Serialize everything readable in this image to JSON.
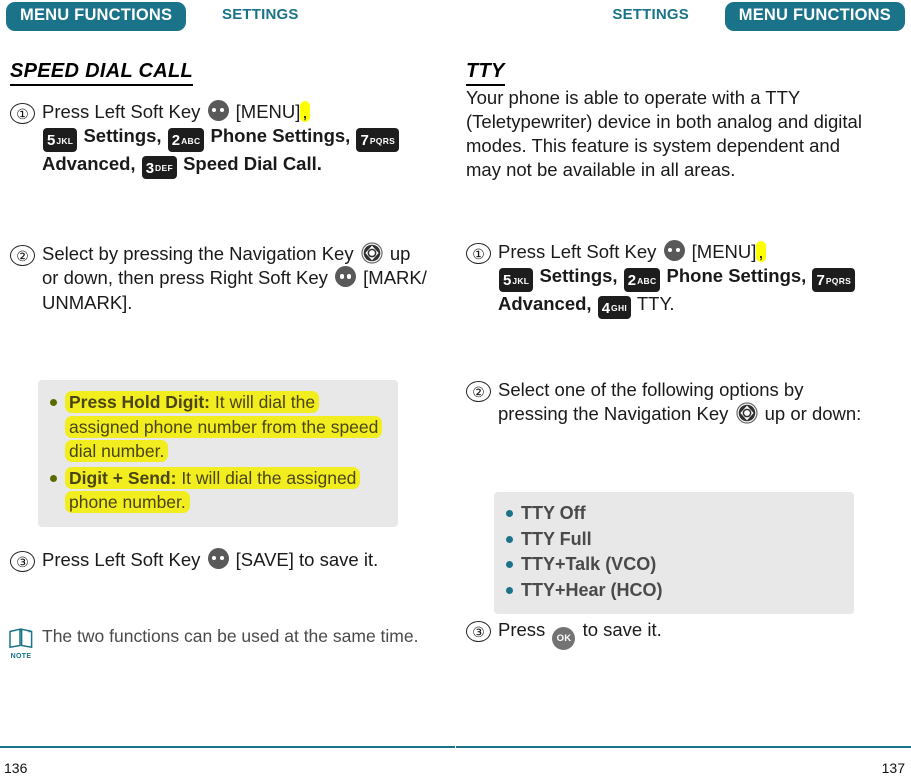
{
  "left_page": {
    "header": {
      "tab": "MENU FUNCTIONS",
      "sub": "SETTINGS"
    },
    "section_title": "SPEED DIAL CALL",
    "steps": [
      {
        "num": "①",
        "text_1": "Press Left Soft Key",
        "soft_key_icon": "soft-key-icon",
        "text_2": "[MENU]",
        "comma_highlight": ",",
        "key_5": {
          "digit": "5",
          "letters": "JKL"
        },
        "label_settings": "Settings,",
        "key_2": {
          "digit": "2",
          "letters": "ABC"
        },
        "label_phone_settings": "Phone Settings,",
        "key_7": {
          "digit": "7",
          "letters": "PQRS"
        },
        "label_advanced": "Advanced,",
        "key_3": {
          "digit": "3",
          "letters": "DEF"
        },
        "label_speed_dial": "Speed Dial Call."
      },
      {
        "num": "②",
        "text_1": "Select by pressing the Navigation Key",
        "nav_key_icon": "navigation-key-icon",
        "text_2": "up or down, then press Right Soft Key",
        "soft_key_icon": "soft-key-icon",
        "text_3": "[MARK/ UNMARK]."
      },
      {
        "num": "③",
        "text_1": "Press Left Soft Key",
        "soft_key_icon": "soft-key-icon",
        "text_2": "[SAVE] to save it."
      }
    ],
    "info_box": {
      "bullets": [
        {
          "bold": "Press Hold Digit:",
          "rest": "It will dial the assigned phone number from the speed dial number."
        },
        {
          "bold": "Digit + Send:",
          "rest": "It will dial the assigned phone number."
        }
      ]
    },
    "note": {
      "icon": "note-book-icon",
      "icon_label": "NOTE",
      "text": "The two functions can be used at the same time."
    },
    "page_number": "136"
  },
  "right_page": {
    "header": {
      "tab": "MENU FUNCTIONS",
      "sub": "SETTINGS"
    },
    "section_title": "TTY",
    "intro": "Your phone is able to operate with a TTY (Teletypewriter) device in both analog and digital modes. This feature is system dependent and may not be available in all areas.",
    "steps": [
      {
        "num": "①",
        "text_1": "Press Left Soft Key",
        "soft_key_icon": "soft-key-icon",
        "text_2": "[MENU]",
        "comma_highlight": ",",
        "key_5": {
          "digit": "5",
          "letters": "JKL"
        },
        "label_settings": "Settings,",
        "key_2": {
          "digit": "2",
          "letters": "ABC"
        },
        "label_phone_settings": "Phone Settings,",
        "key_7": {
          "digit": "7",
          "letters": "PQRS"
        },
        "label_advanced": "Advanced,",
        "key_4": {
          "digit": "4",
          "letters": "GHI"
        },
        "label_tty": "TTY."
      },
      {
        "num": "②",
        "text_1": "Select one of the following options by pressing the Navigation Key",
        "nav_key_icon": "navigation-key-icon",
        "text_2": "up or down:"
      },
      {
        "num": "③",
        "text_1": "Press",
        "ok_key_icon": "ok-key-icon",
        "ok_key_label": "OK",
        "text_2": "to save it."
      }
    ],
    "options_box": {
      "options": [
        "TTY Off",
        "TTY Full",
        "TTY+Talk (VCO)",
        "TTY+Hear (HCO)"
      ]
    },
    "page_number": "137"
  },
  "colors": {
    "brand_teal": "#1a7389",
    "highlight_yellow": "#f2ed1e",
    "key_black": "#1d1d1d",
    "box_gray": "#e8e8e8",
    "bullet_olive": "#5c6b00"
  }
}
